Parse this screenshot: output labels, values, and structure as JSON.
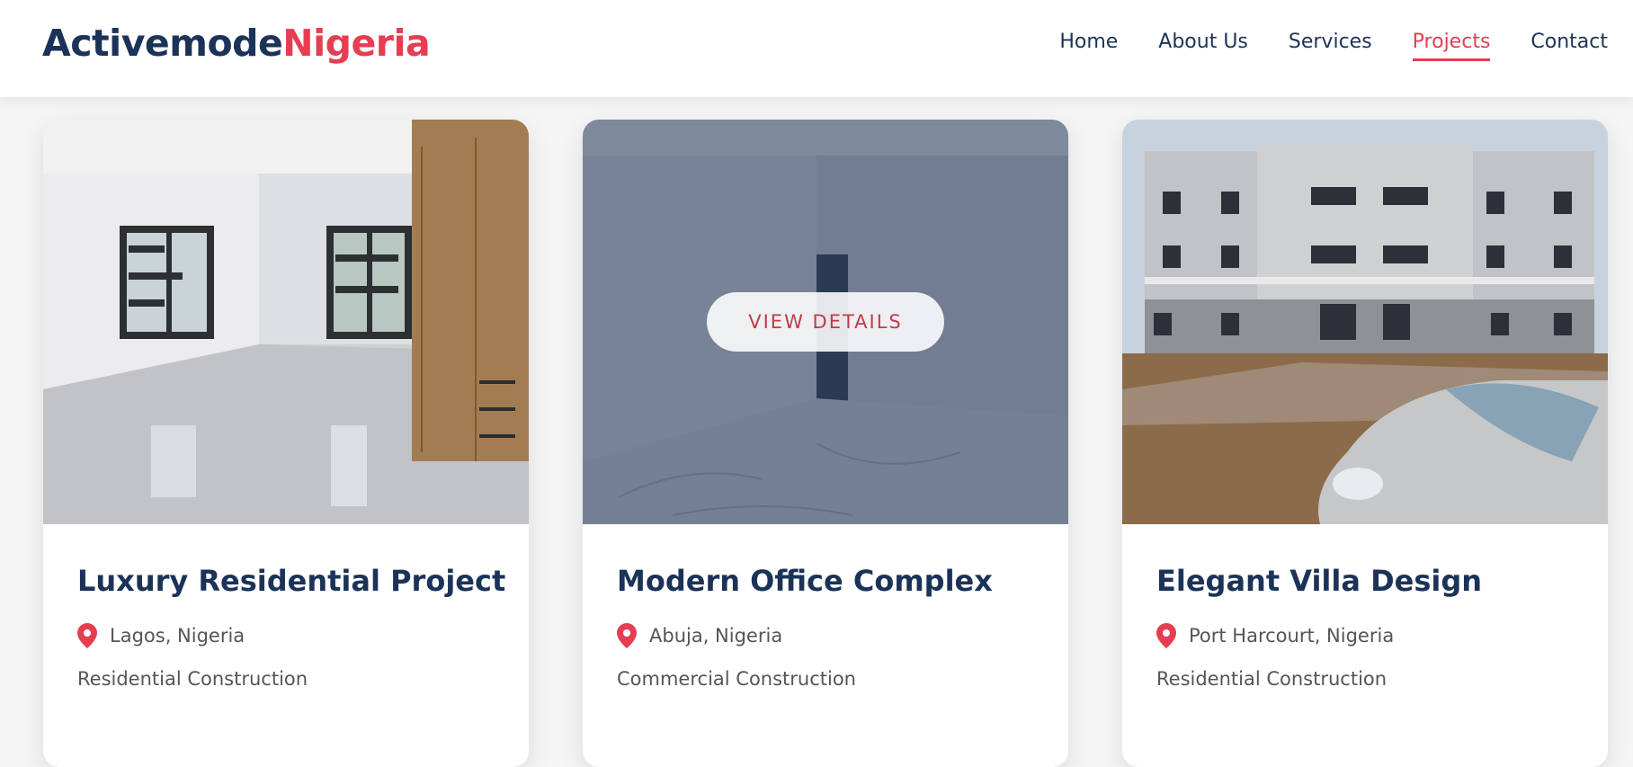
{
  "brand": {
    "part1": "Activemode",
    "part2": "Nigeria"
  },
  "nav": {
    "items": [
      "Home",
      "About Us",
      "Services",
      "Projects",
      "Contact"
    ],
    "active": "Projects"
  },
  "colors": {
    "navy": "#1b3358",
    "accent": "#e53e51"
  },
  "projects": [
    {
      "title": "Luxury Residential Project",
      "location": "Lagos, Nigeria",
      "category": "Residential Construction",
      "image": "bedroom-interior-photo"
    },
    {
      "title": "Modern Office Complex",
      "location": "Abuja, Nigeria",
      "category": "Commercial Construction",
      "image": "office-interior-photo",
      "hover_button": "VIEW DETAILS"
    },
    {
      "title": "Elegant Villa Design",
      "location": "Port Harcourt, Nigeria",
      "category": "Residential Construction",
      "image": "apartment-building-photo"
    }
  ],
  "icons": {
    "location": "map-pin-icon"
  }
}
